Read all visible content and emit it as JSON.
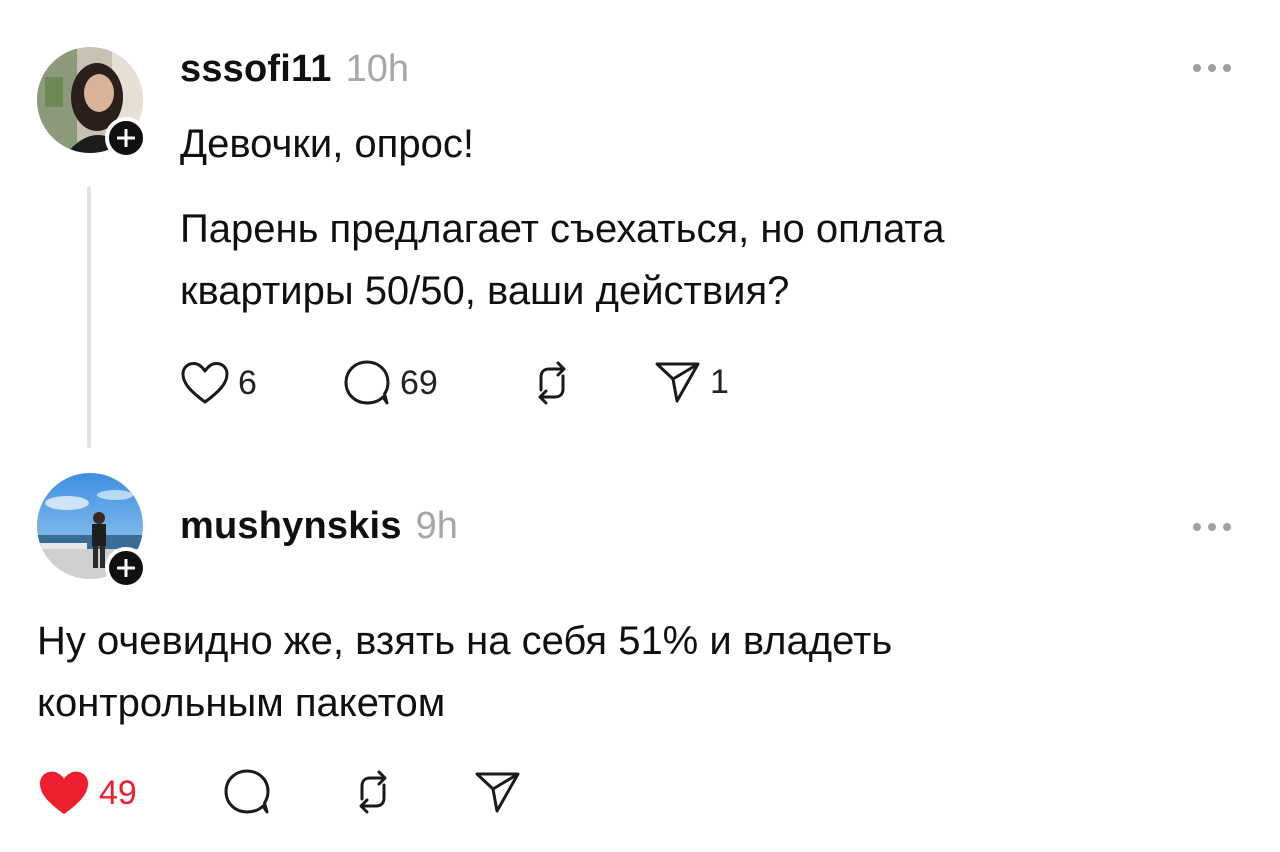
{
  "posts": [
    {
      "username": "sssofi11",
      "time": "10h",
      "title": "Девочки, опрос!",
      "body_line1": "Парень предлагает съехаться, но оплата",
      "body_line2": "квартиры 50/50, ваши действия?",
      "likes": "6",
      "comments": "69",
      "shares": "1",
      "liked": false
    },
    {
      "username": "mushynskis",
      "time": "9h",
      "body_line1": "Ну очевидно же, взять на себя 51% и владеть",
      "body_line2": "контрольным пакетом",
      "likes": "49",
      "liked": true,
      "like_color": "#ed1e2e"
    }
  ]
}
